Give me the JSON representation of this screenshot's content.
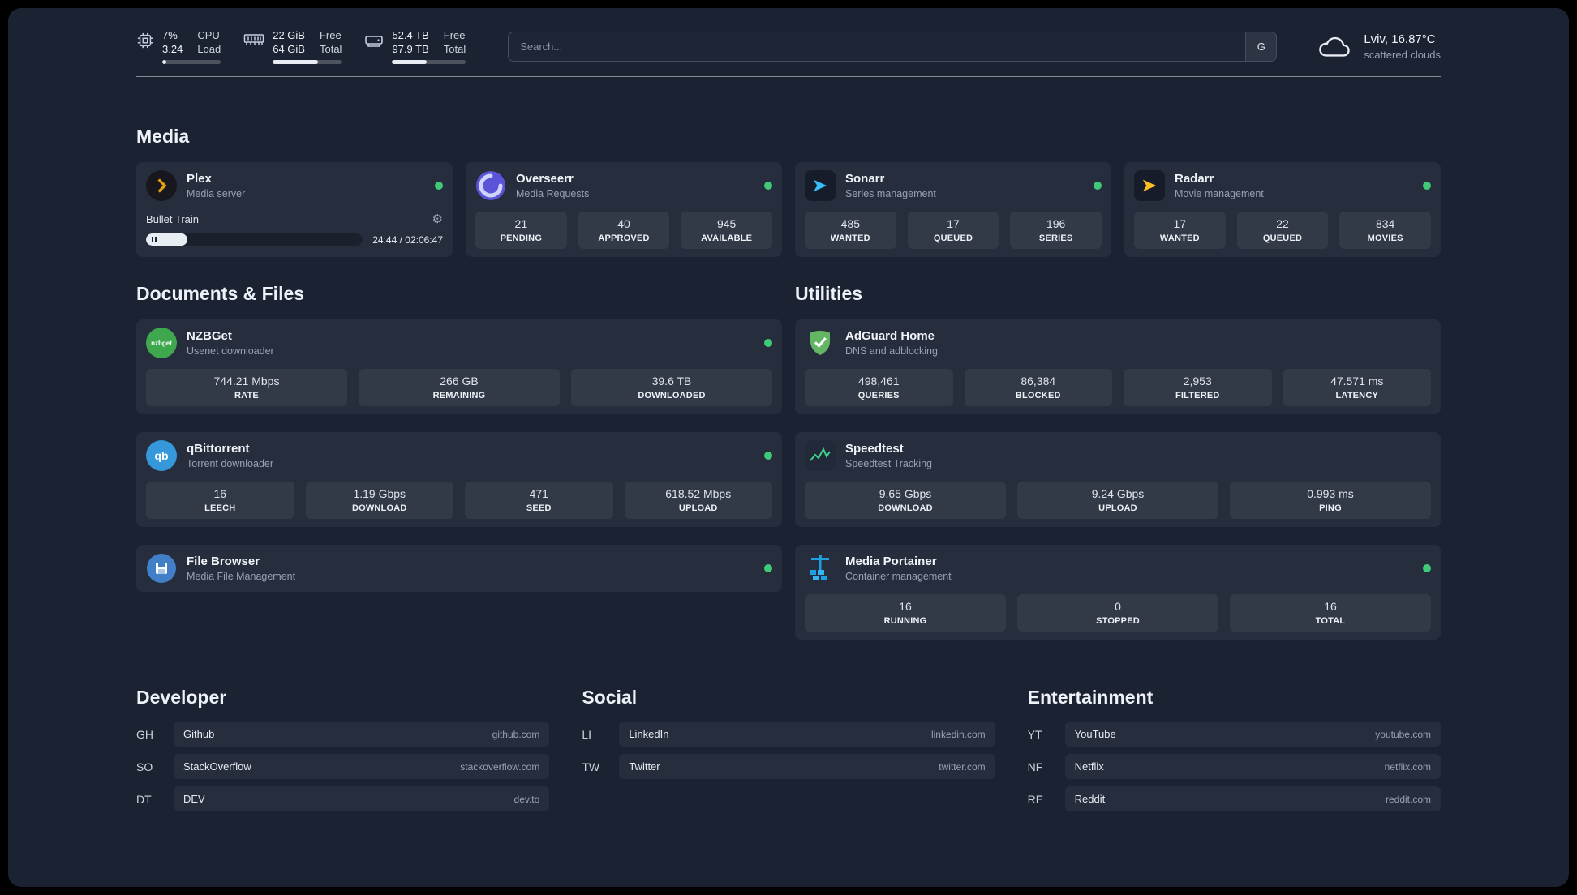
{
  "topbar": {
    "cpu": {
      "value1": "7%",
      "value2": "3.24",
      "label1": "CPU",
      "label2": "Load",
      "progress": 7
    },
    "ram": {
      "value1": "22 GiB",
      "value2": "64 GiB",
      "label1": "Free",
      "label2": "Total",
      "progress": 66
    },
    "disk": {
      "value1": "52.4 TB",
      "value2": "97.9 TB",
      "label1": "Free",
      "label2": "Total",
      "progress": 47
    },
    "search": {
      "placeholder": "Search...",
      "button_label": "G"
    },
    "weather": {
      "location": "Lviv, 16.87°C",
      "condition": "scattered clouds"
    }
  },
  "sections": {
    "media": {
      "heading": "Media",
      "plex": {
        "name": "Plex",
        "desc": "Media server",
        "now_playing": "Bullet Train",
        "time": "24:44 / 02:06:47",
        "progress": 19
      },
      "overseerr": {
        "name": "Overseerr",
        "desc": "Media Requests",
        "stats": [
          {
            "value": "21",
            "label": "PENDING"
          },
          {
            "value": "40",
            "label": "APPROVED"
          },
          {
            "value": "945",
            "label": "AVAILABLE"
          }
        ]
      },
      "sonarr": {
        "name": "Sonarr",
        "desc": "Series management",
        "stats": [
          {
            "value": "485",
            "label": "WANTED"
          },
          {
            "value": "17",
            "label": "QUEUED"
          },
          {
            "value": "196",
            "label": "SERIES"
          }
        ]
      },
      "radarr": {
        "name": "Radarr",
        "desc": "Movie management",
        "stats": [
          {
            "value": "17",
            "label": "WANTED"
          },
          {
            "value": "22",
            "label": "QUEUED"
          },
          {
            "value": "834",
            "label": "MOVIES"
          }
        ]
      }
    },
    "documents": {
      "heading": "Documents & Files",
      "nzbget": {
        "name": "NZBGet",
        "desc": "Usenet downloader",
        "stats": [
          {
            "value": "744.21 Mbps",
            "label": "RATE"
          },
          {
            "value": "266 GB",
            "label": "REMAINING"
          },
          {
            "value": "39.6 TB",
            "label": "DOWNLOADED"
          }
        ]
      },
      "qbittorrent": {
        "name": "qBittorrent",
        "desc": "Torrent downloader",
        "stats": [
          {
            "value": "16",
            "label": "LEECH"
          },
          {
            "value": "1.19 Gbps",
            "label": "DOWNLOAD"
          },
          {
            "value": "471",
            "label": "SEED"
          },
          {
            "value": "618.52 Mbps",
            "label": "UPLOAD"
          }
        ]
      },
      "filebrowser": {
        "name": "File Browser",
        "desc": "Media File Management"
      }
    },
    "utilities": {
      "heading": "Utilities",
      "adguard": {
        "name": "AdGuard Home",
        "desc": "DNS and adblocking",
        "stats": [
          {
            "value": "498,461",
            "label": "QUERIES"
          },
          {
            "value": "86,384",
            "label": "BLOCKED"
          },
          {
            "value": "2,953",
            "label": "FILTERED"
          },
          {
            "value": "47.571 ms",
            "label": "LATENCY"
          }
        ]
      },
      "speedtest": {
        "name": "Speedtest",
        "desc": "Speedtest Tracking",
        "stats": [
          {
            "value": "9.65 Gbps",
            "label": "DOWNLOAD"
          },
          {
            "value": "9.24 Gbps",
            "label": "UPLOAD"
          },
          {
            "value": "0.993 ms",
            "label": "PING"
          }
        ]
      },
      "portainer": {
        "name": "Media Portainer",
        "desc": "Container management",
        "stats": [
          {
            "value": "16",
            "label": "RUNNING"
          },
          {
            "value": "0",
            "label": "STOPPED"
          },
          {
            "value": "16",
            "label": "TOTAL"
          }
        ]
      }
    }
  },
  "bookmarks": [
    {
      "heading": "Developer",
      "items": [
        {
          "abbr": "GH",
          "name": "Github",
          "url": "github.com"
        },
        {
          "abbr": "SO",
          "name": "StackOverflow",
          "url": "stackoverflow.com"
        },
        {
          "abbr": "DT",
          "name": "DEV",
          "url": "dev.to"
        }
      ]
    },
    {
      "heading": "Social",
      "items": [
        {
          "abbr": "LI",
          "name": "LinkedIn",
          "url": "linkedin.com"
        },
        {
          "abbr": "TW",
          "name": "Twitter",
          "url": "twitter.com"
        }
      ]
    },
    {
      "heading": "Entertainment",
      "items": [
        {
          "abbr": "YT",
          "name": "YouTube",
          "url": "youtube.com"
        },
        {
          "abbr": "NF",
          "name": "Netflix",
          "url": "netflix.com"
        },
        {
          "abbr": "RE",
          "name": "Reddit",
          "url": "reddit.com"
        }
      ]
    }
  ],
  "icons": {
    "gear": "⚙",
    "qbittorrent_text": "qb",
    "nzbget_text": "nzbget"
  },
  "colors": {
    "status_online": "#41c977"
  }
}
